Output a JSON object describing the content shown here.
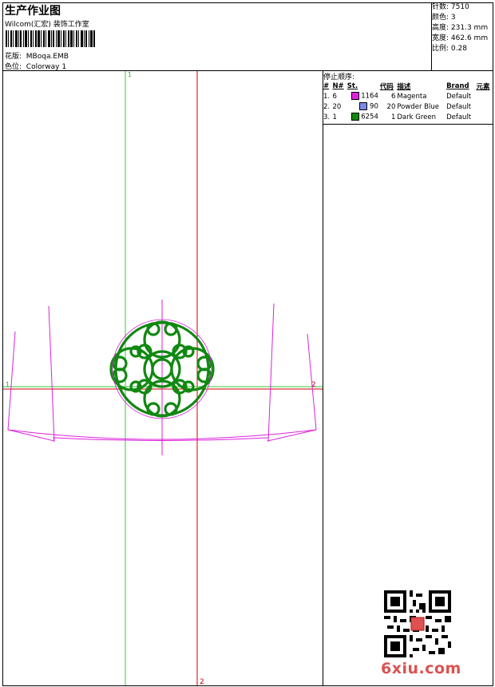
{
  "header": {
    "title": "生产作业图",
    "company": "Wilcom(汇宏) 装饰工作室",
    "design_label": "花版:",
    "design_value": "MBoqa.EMB",
    "colorway_label": "色位:",
    "colorway_value": "Colorway 1"
  },
  "stats": [
    {
      "label": "针数:",
      "value": "7510"
    },
    {
      "label": "颜色:",
      "value": "3"
    },
    {
      "label": "高度:",
      "value": "231.3 mm"
    },
    {
      "label": "宽度:",
      "value": "462.6 mm"
    },
    {
      "label": "比例:",
      "value": "0.28"
    }
  ],
  "stop_sequence": {
    "title": "停止顺序:",
    "headers": [
      "#",
      "N#",
      "St.",
      "代码",
      "描述",
      "Brand",
      "元素"
    ],
    "rows": [
      {
        "idx": "1.",
        "n": "6",
        "color": "#e020e0",
        "st": "1164",
        "code": "6",
        "desc": "Magenta",
        "brand": "Default"
      },
      {
        "idx": "2.",
        "n": "20",
        "color": "#7a8ae6",
        "st": "90",
        "code": "20",
        "desc": "Powder Blue",
        "brand": "Default"
      },
      {
        "idx": "3.",
        "n": "1",
        "color": "#118811",
        "st": "6254",
        "code": "1",
        "desc": "Dark Green",
        "brand": "Default"
      }
    ]
  },
  "canvas": {
    "axis_labels": [
      "1",
      "2",
      "1",
      "2"
    ]
  },
  "watermark": {
    "text": "6xiu.com"
  },
  "colors": {
    "green_axis": "#33cc33",
    "red_axis": "#cc0000",
    "magenta": "#dd22dd",
    "green_design": "#118811"
  },
  "icons": [
    "barcode-icon",
    "qr-code-icon"
  ]
}
